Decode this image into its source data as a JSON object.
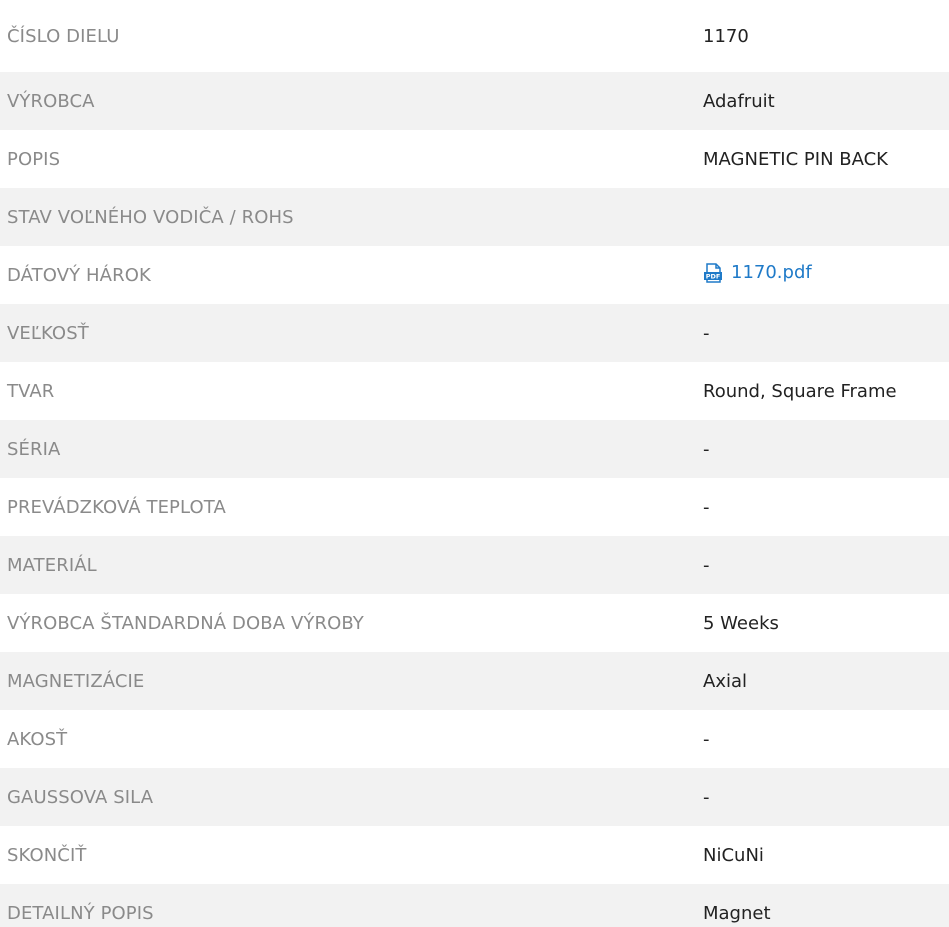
{
  "colors": {
    "label": "#8a8a8a",
    "value": "#222222",
    "link": "#1f7ac8",
    "row_shade": "#f2f2f2"
  },
  "rows": [
    {
      "label": "ČÍSLO DIELU",
      "value": "1170"
    },
    {
      "label": "VÝROBCA",
      "value": "Adafruit"
    },
    {
      "label": "POPIS",
      "value": "MAGNETIC PIN BACK"
    },
    {
      "label": "STAV VOĽNÉHO VODIČA / ROHS",
      "value": ""
    },
    {
      "label": "DÁTOVÝ HÁROK",
      "value": "1170.pdf",
      "icon": "pdf-icon"
    },
    {
      "label": "VEĽKOSŤ",
      "value": "-"
    },
    {
      "label": "TVAR",
      "value": "Round, Square Frame"
    },
    {
      "label": "SÉRIA",
      "value": "-"
    },
    {
      "label": "PREVÁDZKOVÁ TEPLOTA",
      "value": "-"
    },
    {
      "label": "MATERIÁL",
      "value": "-"
    },
    {
      "label": "VÝROBCA ŠTANDARDNÁ DOBA VÝROBY",
      "value": "5 Weeks"
    },
    {
      "label": "MAGNETIZÁCIE",
      "value": "Axial"
    },
    {
      "label": "AKOSŤ",
      "value": "-"
    },
    {
      "label": "GAUSSOVA SILA",
      "value": "-"
    },
    {
      "label": "SKONČIŤ",
      "value": "NiCuNi"
    },
    {
      "label": "DETAILNÝ POPIS",
      "value": "Magnet"
    }
  ]
}
